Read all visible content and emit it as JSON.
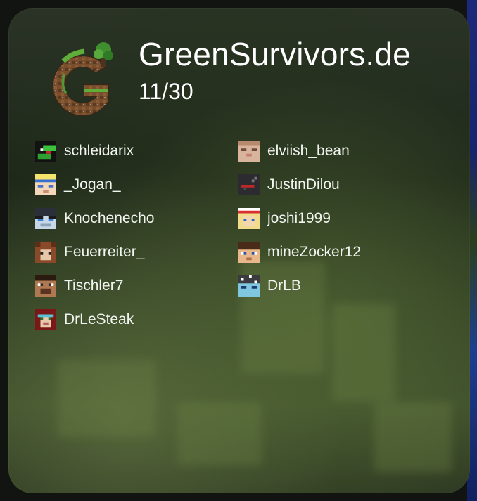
{
  "server": {
    "name": "GreenSurvivors.de",
    "player_count": "11/30",
    "logo": "greensurvivors-g-logo"
  },
  "players": {
    "left": [
      {
        "name": "schleidarix",
        "icon": "skin-head-schleidarix"
      },
      {
        "name": "_Jogan_",
        "icon": "skin-head-jogan"
      },
      {
        "name": "Knochenecho",
        "icon": "skin-head-knochenecho"
      },
      {
        "name": "Feuerreiter_",
        "icon": "skin-head-feuerreiter"
      },
      {
        "name": "Tischler7",
        "icon": "skin-head-tischler7"
      },
      {
        "name": "DrLeSteak",
        "icon": "skin-head-drlesteak"
      }
    ],
    "right": [
      {
        "name": "elviish_bean",
        "icon": "skin-head-elviish-bean"
      },
      {
        "name": "JustinDilou",
        "icon": "skin-head-justindilou"
      },
      {
        "name": "joshi1999",
        "icon": "skin-head-joshi1999"
      },
      {
        "name": "mineZocker12",
        "icon": "skin-head-minezocker12"
      },
      {
        "name": "DrLB",
        "icon": "skin-head-drlb"
      }
    ]
  }
}
